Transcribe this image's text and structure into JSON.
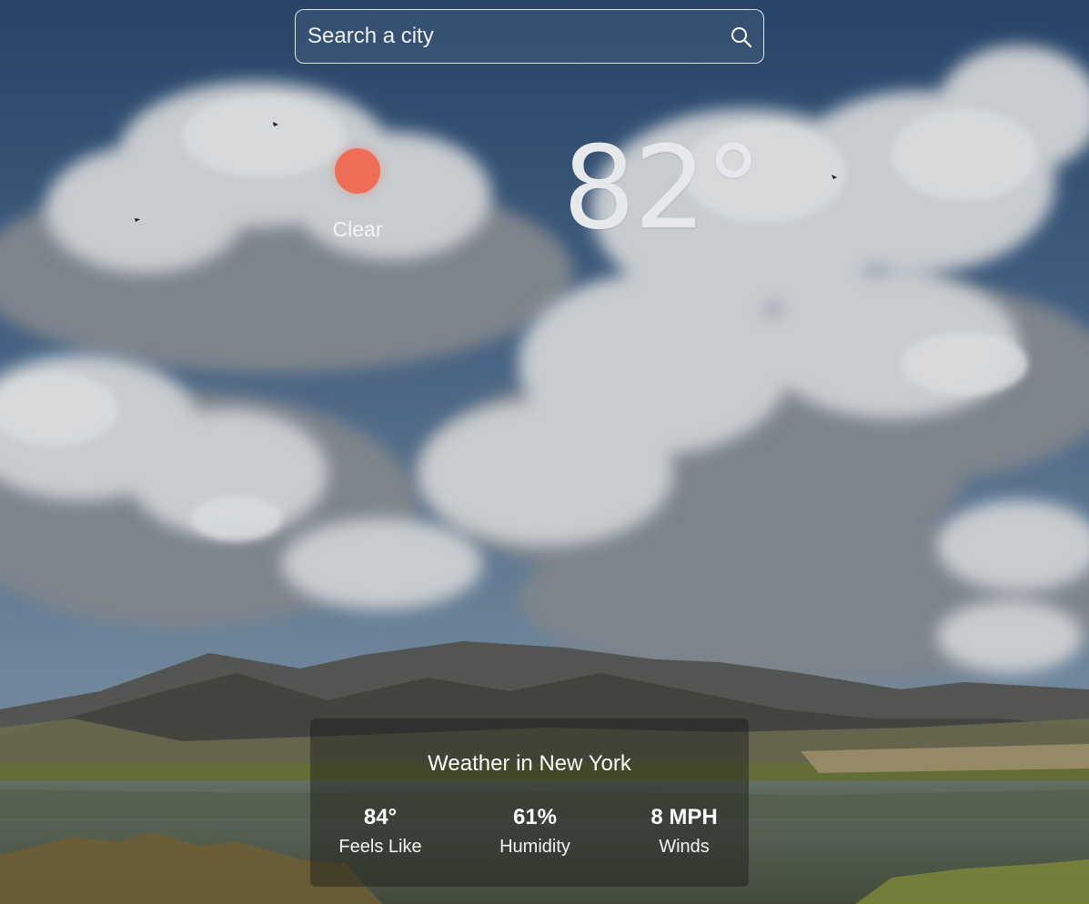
{
  "search": {
    "placeholder": "Search a city",
    "value": "",
    "icon": "search-icon"
  },
  "current": {
    "icon": "sun-icon",
    "icon_color": "#ee6d56",
    "condition": "Clear",
    "temperature": "82°"
  },
  "details": {
    "title": "Weather in New York",
    "stats": [
      {
        "value": "84°",
        "label": "Feels Like"
      },
      {
        "value": "61%",
        "label": "Humidity"
      },
      {
        "value": "8 MPH",
        "label": "Winds"
      }
    ]
  },
  "background": {
    "content": "sky-clouds-mountains-lake-photo"
  }
}
